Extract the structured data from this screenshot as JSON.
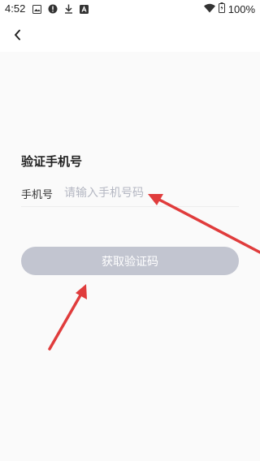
{
  "status_bar": {
    "time": "4:52",
    "battery": "100%",
    "icons": [
      "image-icon",
      "alert-icon",
      "download-icon",
      "app-icon",
      "wifi-icon",
      "battery-icon"
    ]
  },
  "nav": {
    "back_icon": "chevron-left-icon"
  },
  "page": {
    "title": "验证手机号",
    "phone_label": "手机号",
    "phone_placeholder": "请输入手机号码",
    "phone_value": "",
    "get_code_label": "获取验证码"
  },
  "colors": {
    "button_bg": "#c2c5d0",
    "placeholder": "#b4b7c2",
    "arrow": "#e03c3c"
  }
}
